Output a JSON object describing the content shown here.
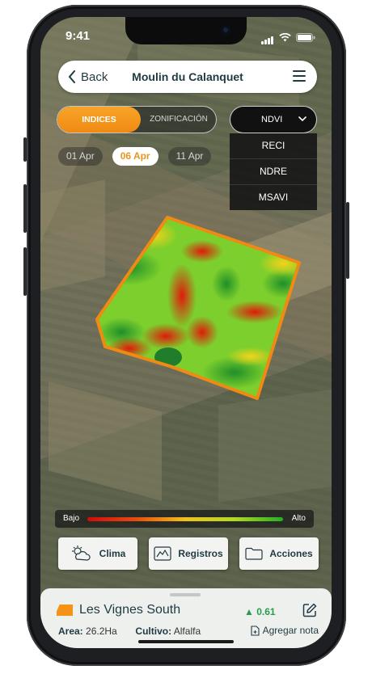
{
  "status": {
    "time": "9:41"
  },
  "header": {
    "back_label": "Back",
    "title": "Moulin du Calanquet"
  },
  "mode_tabs": {
    "active": "INDICES",
    "inactive": "ZONIFICACIÓN"
  },
  "dates": [
    {
      "label": "01 Apr"
    },
    {
      "label": "06 Apr"
    },
    {
      "label": "11 Apr"
    }
  ],
  "index_dropdown": {
    "selected": "NDVI",
    "options": [
      "RECI",
      "NDRE",
      "MSAVI"
    ]
  },
  "legend": {
    "low": "Bajo",
    "high": "Alto",
    "colors": [
      "#d10a0a",
      "#f2c21a",
      "#23b020"
    ]
  },
  "actions": {
    "weather": "Clima",
    "records": "Registros",
    "actions": "Acciones"
  },
  "field": {
    "name": "Les Vignes South",
    "area_label": "Area:",
    "area_value": "26.2Ha",
    "crop_label": "Cultivo:",
    "crop_value": "Alfalfa",
    "ndvi_value": "0.61",
    "add_note": "Agregar nota"
  },
  "colors": {
    "accent": "#f39419",
    "ink": "#1f3a42",
    "positive": "#2a9b4a"
  }
}
